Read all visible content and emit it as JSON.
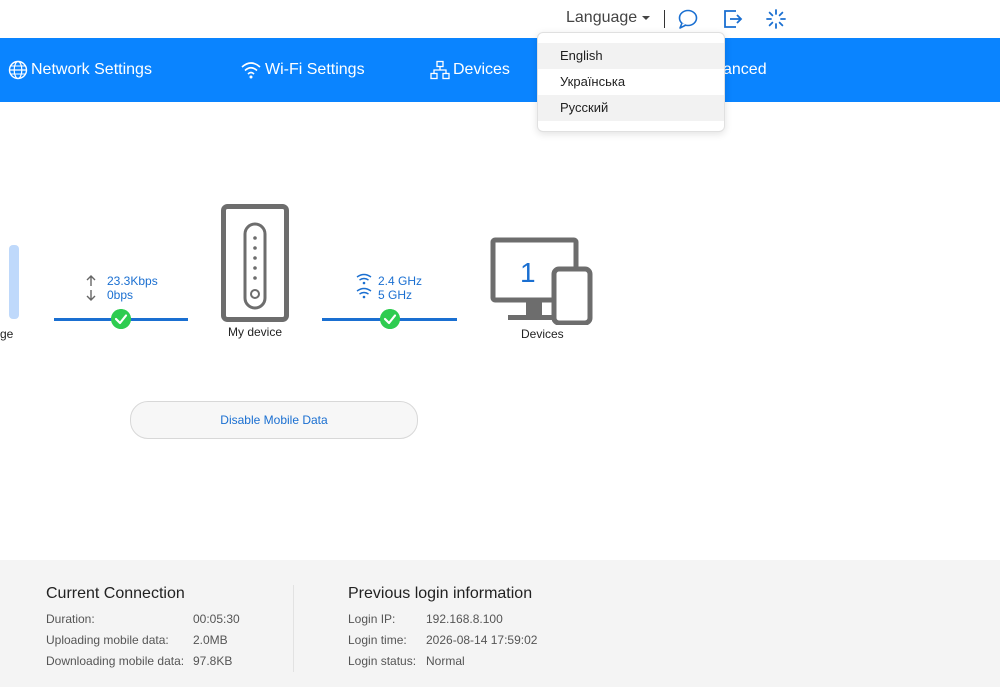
{
  "header": {
    "language_label": "Language",
    "icons": [
      "message-icon",
      "logout-icon",
      "loading-icon"
    ]
  },
  "nav": {
    "items": [
      {
        "label": "Network Settings",
        "icon": "globe-icon"
      },
      {
        "label": "Wi-Fi Settings",
        "icon": "wifi-icon"
      },
      {
        "label": "Devices",
        "icon": "network-icon"
      },
      {
        "label": "anced",
        "icon": ""
      }
    ]
  },
  "language_menu": {
    "options": [
      "English",
      "Українська",
      "Русский"
    ]
  },
  "status": {
    "left_label": "ge",
    "upload_speed": "23.3Kbps",
    "download_speed": "0bps",
    "router_label": "My device",
    "band_24": "2.4 GHz",
    "band_5": "5 GHz",
    "devices_count": "1",
    "devices_label": "Devices",
    "disable_button": "Disable Mobile Data"
  },
  "current_connection": {
    "title": "Current Connection",
    "rows": [
      {
        "label": "Duration:",
        "value": "00:05:30"
      },
      {
        "label": "Uploading mobile data:",
        "value": "2.0MB"
      },
      {
        "label": "Downloading mobile data:",
        "value": "97.8KB"
      }
    ]
  },
  "previous_login": {
    "title": "Previous login information",
    "rows": [
      {
        "label": "Login IP:",
        "value": "192.168.8.100"
      },
      {
        "label": "Login time:",
        "value": "2026-08-14 17:59:02"
      },
      {
        "label": "Login status:",
        "value": "Normal"
      }
    ]
  },
  "colors": {
    "nav_bg": "#0a84ff",
    "accent": "#1a6fd1",
    "success": "#2ecc50",
    "device_gray": "#6d6d6d"
  }
}
